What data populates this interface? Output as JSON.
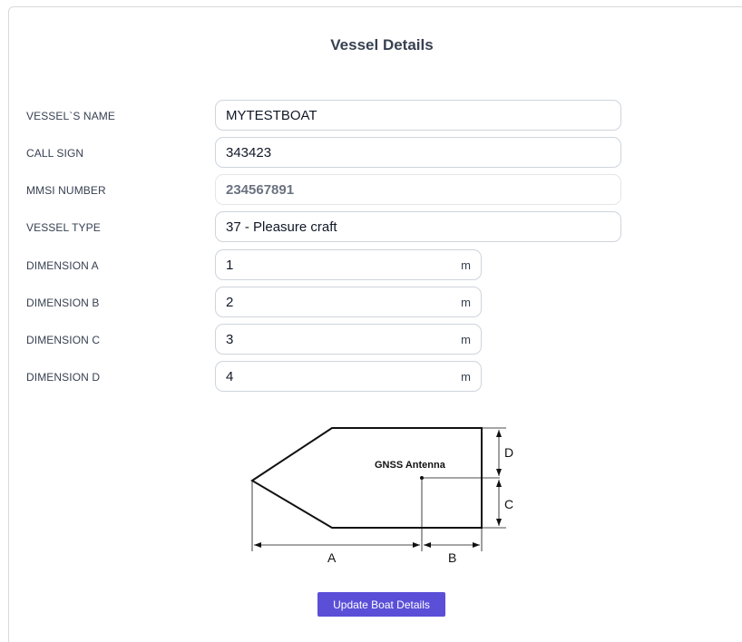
{
  "title": "Vessel Details",
  "fields": {
    "vessel_name": {
      "label": "VESSEL`S NAME",
      "value": "MYTESTBOAT"
    },
    "call_sign": {
      "label": "CALL SIGN",
      "value": "343423"
    },
    "mmsi": {
      "label": "MMSI NUMBER",
      "value": "234567891"
    },
    "vessel_type": {
      "label": "VESSEL TYPE",
      "value": "37 - Pleasure craft"
    },
    "dim_a": {
      "label": "DIMENSION A",
      "value": "1",
      "unit": "m"
    },
    "dim_b": {
      "label": "DIMENSION B",
      "value": "2",
      "unit": "m"
    },
    "dim_c": {
      "label": "DIMENSION C",
      "value": "3",
      "unit": "m"
    },
    "dim_d": {
      "label": "DIMENSION D",
      "value": "4",
      "unit": "m"
    }
  },
  "diagram": {
    "antenna_label": "GNSS Antenna",
    "label_a": "A",
    "label_b": "B",
    "label_c": "C",
    "label_d": "D"
  },
  "update_button_label": "Update Boat Details",
  "colors": {
    "button": "#5b4fd8",
    "border": "#cfd4dc",
    "text": "#374151"
  }
}
